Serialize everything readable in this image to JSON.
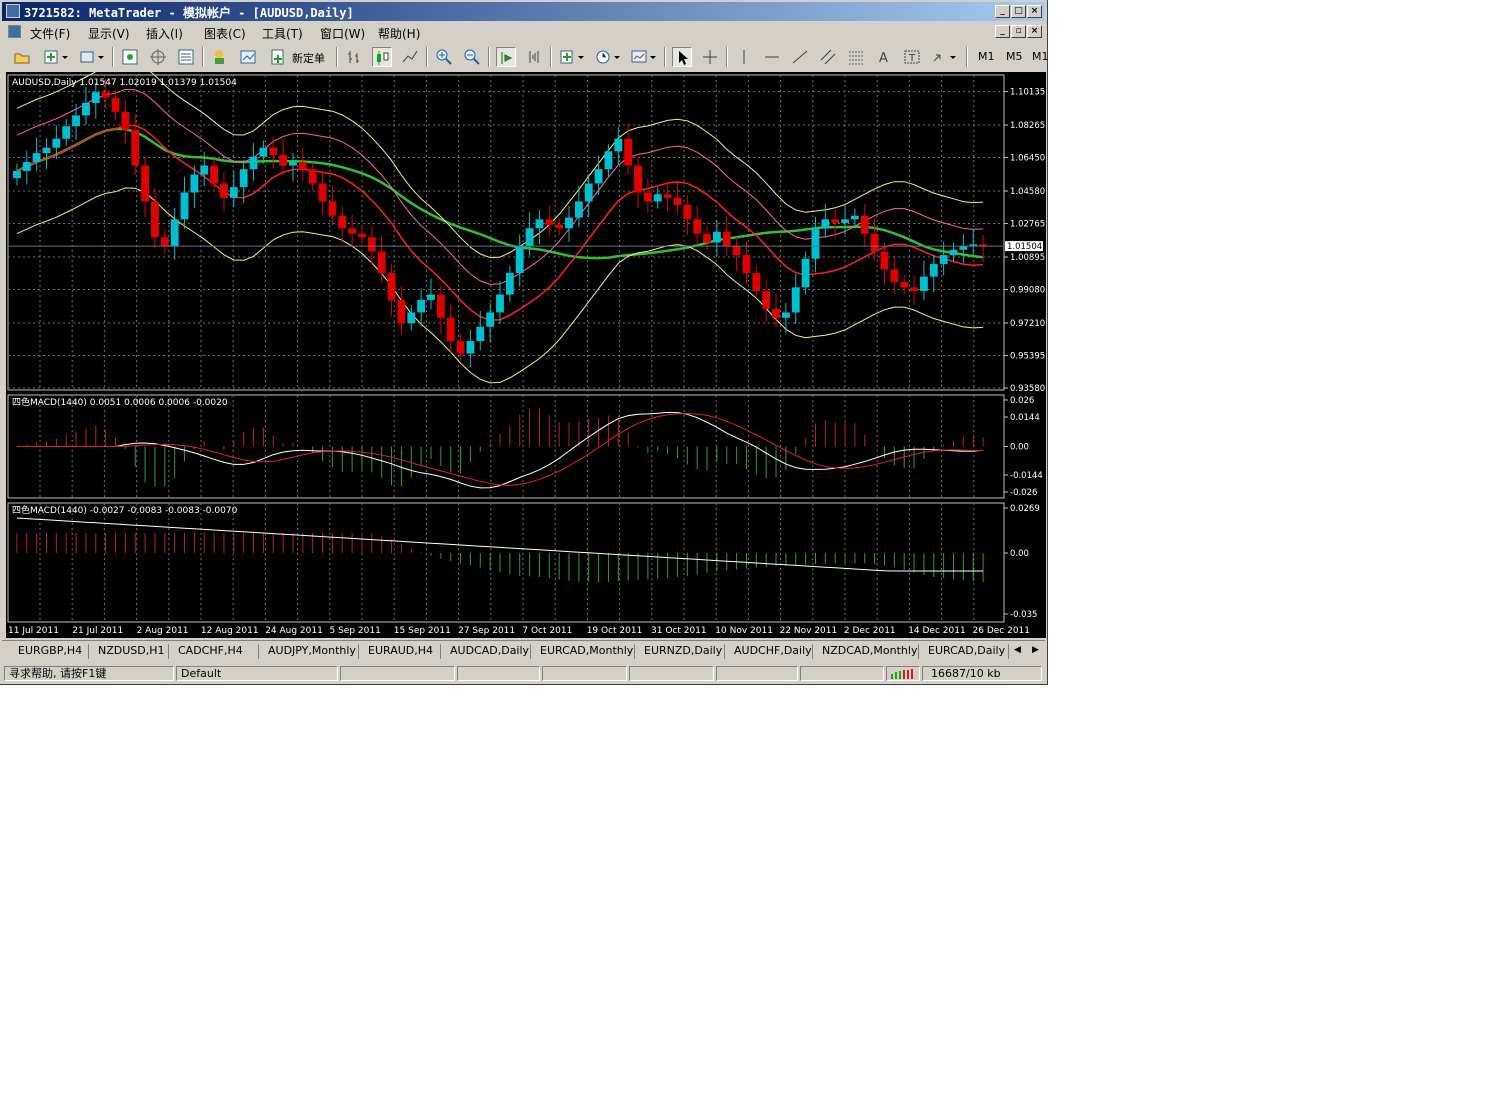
{
  "window": {
    "title": "3721582: MetaTrader - 模拟帐户 - [AUDUSD,Daily]",
    "controls": [
      "_",
      "□",
      "×"
    ]
  },
  "menu": [
    {
      "label": "文件(F)"
    },
    {
      "label": "显示(V)"
    },
    {
      "label": "插入(I)"
    },
    {
      "label": "图表(C)"
    },
    {
      "label": "工具(T)"
    },
    {
      "label": "窗口(W)"
    },
    {
      "label": "帮助(H)"
    }
  ],
  "toolbar": {
    "new_order_label": "新定单",
    "timeframes": [
      "M1",
      "M5",
      "M1"
    ]
  },
  "chart": {
    "symbol_info": "AUDUSD,Daily  1.01547 1.02019 1.01379 1.01504",
    "current_price": "1.01504",
    "price_ticks": [
      "1.10135",
      "1.08265",
      "1.06450",
      "1.04580",
      "1.02765",
      "1.00895",
      "0.99080",
      "0.97210",
      "0.95395",
      "0.93580"
    ],
    "macd1_label": "四色MACD(1440) 0.0051 0.0006 0.0006 -0.0020",
    "macd1_ticks": [
      "0.026",
      "0.0144",
      "0.00",
      "-0.0144",
      "-0.026"
    ],
    "macd2_label": "四色MACD(1440) -0.0027 -0.0083 -0.0083 -0.0070",
    "macd2_ticks": [
      "0.0269",
      "0.00",
      "-0.035"
    ],
    "date_ticks": [
      "11 Jul 2011",
      "21 Jul 2011",
      "2 Aug 2011",
      "12 Aug 2011",
      "24 Aug 2011",
      "5 Sep 2011",
      "15 Sep 2011",
      "27 Sep 2011",
      "7 Oct 2011",
      "19 Oct 2011",
      "31 Oct 2011",
      "10 Nov 2011",
      "22 Nov 2011",
      "2 Dec 2011",
      "14 Dec 2011",
      "26 Dec 2011"
    ],
    "colors": {
      "bull": "#00c0d0",
      "bear": "#e00000",
      "ma_green": "#30c030",
      "ma_red": "#ff2020",
      "band_yellow": "#f0f080",
      "band_pink": "#ff60a0"
    }
  },
  "tabs": [
    "EURGBP,H4",
    "NZDUSD,H1",
    "CADCHF,H4",
    "AUDJPY,Monthly",
    "EURAUD,H4",
    "AUDCAD,Daily",
    "EURCAD,Monthly",
    "EURNZD,Daily",
    "AUDCHF,Daily",
    "NZDCAD,Monthly",
    "EURCAD,Daily"
  ],
  "status": {
    "help": "寻求帮助, 请按F1键",
    "profile": "Default",
    "traffic": "16687/10 kb"
  }
}
